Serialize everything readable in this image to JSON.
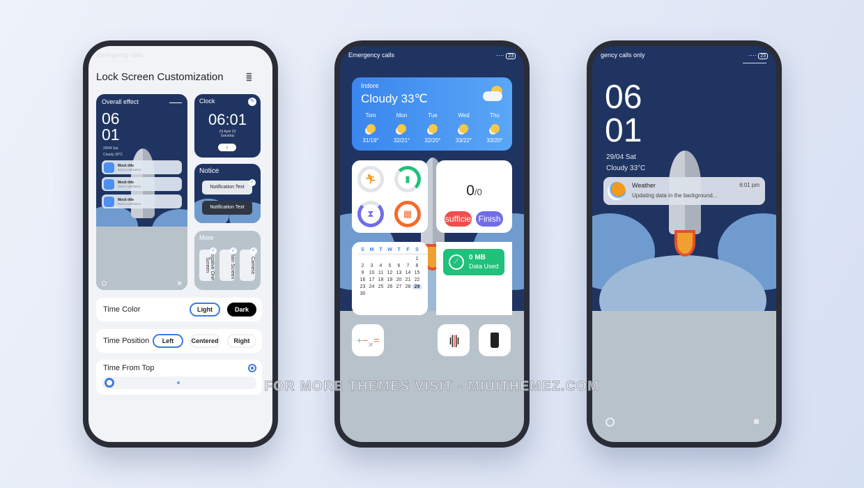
{
  "phone1": {
    "status": "Emergency calls",
    "title": "Lock Screen Customization",
    "overall": {
      "label": "Overall effect",
      "hour": "06",
      "minute": "01",
      "date": "29/04 Sat",
      "weather": "Cloudy 33°C",
      "notifications": [
        {
          "title": "Mock title",
          "text": "Mock notification"
        },
        {
          "title": "Mock title",
          "text": "Mock notification"
        },
        {
          "title": "Mock title",
          "text": "Mock notification"
        }
      ]
    },
    "clock": {
      "label": "Clock",
      "time": "06:01",
      "date": "29 April 23",
      "day": "Saturday"
    },
    "notice": {
      "label": "Notice",
      "light": "Notification Text",
      "dark": "Notification Text"
    },
    "more": {
      "label": "More",
      "items": [
        "Negative One Screen",
        "Main Screen",
        "Camera"
      ]
    },
    "time_color": {
      "label": "Time Color",
      "options": [
        "Light",
        "Dark"
      ],
      "selected": "Light"
    },
    "time_position": {
      "label": "Time Position",
      "options": [
        "Left",
        "Centered",
        "Right"
      ],
      "selected": "Left"
    },
    "time_from_top": {
      "label": "Time From Top",
      "enabled": true,
      "slider_value": 0
    }
  },
  "phone2": {
    "status": "Emergency calls",
    "battery": "23",
    "weather": {
      "city": "Indore",
      "current": "Cloudy 33℃",
      "forecast": [
        {
          "day": "Tom",
          "temp": "31/19°"
        },
        {
          "day": "Mon",
          "temp": "32/21°"
        },
        {
          "day": "Tue",
          "temp": "32/20°"
        },
        {
          "day": "Wed",
          "temp": "33/22°"
        },
        {
          "day": "Thu",
          "temp": "33/20°"
        }
      ]
    },
    "counter": {
      "value": "0",
      "total": "/0",
      "btn_left": "sufficie",
      "btn_right": "Finish"
    },
    "calendar": {
      "days": [
        "S",
        "M",
        "T",
        "W",
        "T",
        "F",
        "S"
      ],
      "dates": [
        "",
        "",
        "",
        "",
        "",
        "",
        "1",
        "2",
        "3",
        "4",
        "5",
        "6",
        "7",
        "8",
        "9",
        "10",
        "11",
        "12",
        "13",
        "14",
        "15",
        "16",
        "17",
        "18",
        "19",
        "20",
        "21",
        "22",
        "23",
        "24",
        "25",
        "26",
        "27",
        "28",
        "29",
        "30"
      ],
      "today": "29"
    },
    "data": {
      "value": "0 MB",
      "label": "Data Used"
    },
    "colors": {
      "weather": "#3d8ef0",
      "data": "#1fc17b",
      "red": "#f04e4e",
      "purple": "#6f6de8",
      "orange": "#f36b2c"
    }
  },
  "phone3": {
    "status": "gency calls only",
    "battery": "23",
    "hour": "06",
    "minute": "01",
    "date": "29/04 Sat",
    "weather": "Cloudy 33°C",
    "notification": {
      "app": "Weather",
      "time": "6:01 pm",
      "text": "Updating data in the background..."
    }
  },
  "watermark": "FOR MORE THEMES VISIT - MIUITHEMEZ.COM"
}
